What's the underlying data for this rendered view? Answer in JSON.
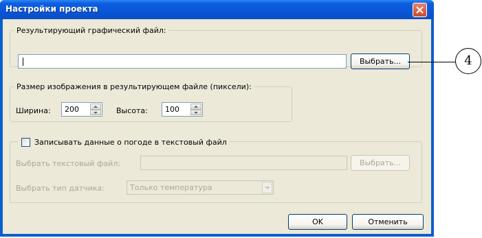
{
  "window": {
    "title": "Настройки проекта"
  },
  "output_file": {
    "group_label": "Результирующий графический файл:",
    "path_value": "",
    "browse_label": "Выбрать..."
  },
  "image_size": {
    "group_label": "Размер изображения в результирующем файле (пиксели):",
    "width_label": "Ширина:",
    "width_value": "200",
    "height_label": "Высота:",
    "height_value": "100"
  },
  "weather": {
    "checkbox_label": "Записывать данные о погоде в текстовый файл",
    "checked": false,
    "text_file_label": "Выбрать текстовый файл:",
    "text_file_value": "",
    "browse_label": "Выбрать...",
    "sensor_label": "Выбрать тип датчика:",
    "sensor_value": "Только температура"
  },
  "buttons": {
    "ok": "OK",
    "cancel": "Отменить"
  },
  "callout": {
    "number": "4"
  }
}
